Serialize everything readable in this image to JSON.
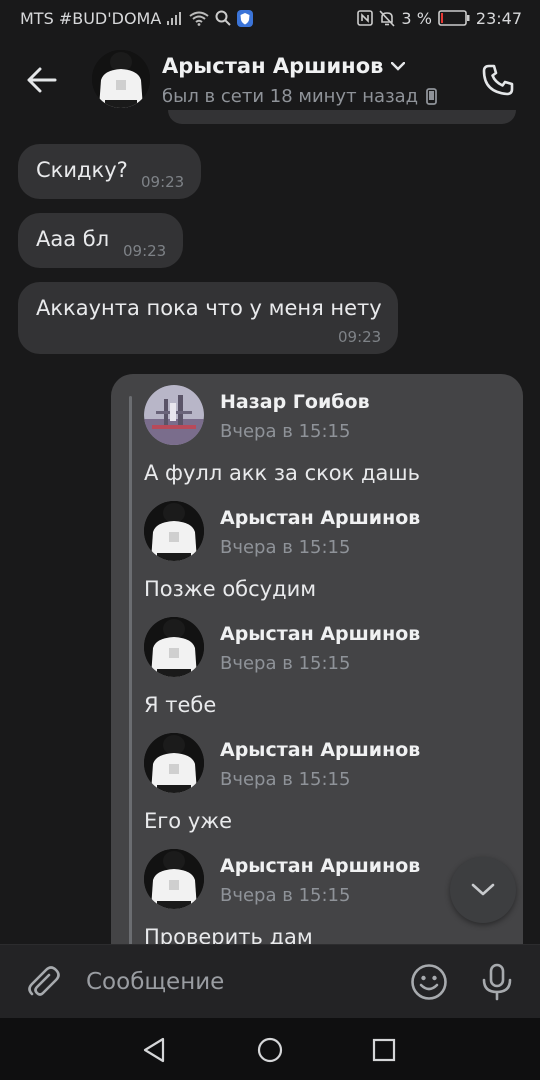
{
  "status_bar": {
    "carrier": "MTS #BUD'DOMA",
    "battery_percent": "3 %",
    "time": "23:47"
  },
  "header": {
    "contact_name": "Арыстан Аршинов",
    "last_seen": "был в сети 18 минут назад"
  },
  "messages": [
    {
      "text": "Скидку?",
      "time": "09:23"
    },
    {
      "text": "Ааа бл",
      "time": "09:23"
    },
    {
      "text": "Аккаунта пока что у меня нету",
      "time": "09:23"
    }
  ],
  "forwarded": [
    {
      "author": "Назар Гоибов",
      "date": "Вчера в 15:15",
      "text": "А фулл акк за скок дашь",
      "avatar": "landscape"
    },
    {
      "author": "Арыстан Аршинов",
      "date": "Вчера в 15:15",
      "text": "Позже обсудим",
      "avatar": "person"
    },
    {
      "author": "Арыстан Аршинов",
      "date": "Вчера в 15:15",
      "text": "Я тебе",
      "avatar": "person"
    },
    {
      "author": "Арыстан Аршинов",
      "date": "Вчера в 15:15",
      "text": "Его уже",
      "avatar": "person"
    },
    {
      "author": "Арыстан Аршинов",
      "date": "Вчера в 15:15",
      "text": "Проверить дам",
      "avatar": "person"
    }
  ],
  "composer": {
    "placeholder": "Сообщение"
  },
  "icons": {
    "back": "arrow-left-icon",
    "call": "phone-icon",
    "attach": "paperclip-icon",
    "emoji": "smiley-icon",
    "mic": "microphone-icon",
    "scroll_down": "chevron-down-icon"
  },
  "colors": {
    "background": "#19191a",
    "bubble": "#333335",
    "forward_bubble": "#444446",
    "secondary_text": "#8f9399"
  }
}
